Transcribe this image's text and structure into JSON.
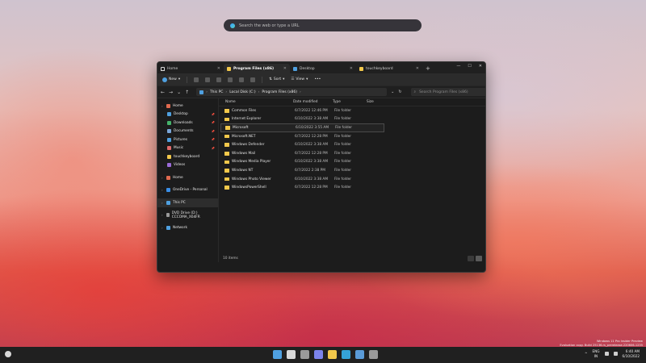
{
  "search": {
    "placeholder": "Search the web or type a URL"
  },
  "tabs": [
    {
      "label": "Home",
      "icon": "home-icon"
    },
    {
      "label": "Program Files (x86)",
      "icon": "folder-icon"
    },
    {
      "label": "Desktop",
      "icon": "desktop-icon"
    },
    {
      "label": "touchkeyboard",
      "icon": "folder-icon"
    }
  ],
  "window_controls": {
    "minimize": "—",
    "maximize": "☐",
    "close": "✕"
  },
  "toolbar": {
    "new_label": "New",
    "sort_label": "Sort",
    "view_label": "View",
    "more_label": "•••"
  },
  "address": {
    "crumbs": [
      "This PC",
      "Local Disk (C:)",
      "Program Files (x86)"
    ],
    "search_placeholder": "Search Program Files (x86)"
  },
  "sidebar": {
    "items": [
      {
        "label": "Home",
        "icon": "home-icon",
        "color": "#e06a4f",
        "level": 0
      },
      {
        "label": "Desktop",
        "icon": "desktop-icon",
        "color": "#4fa0e0",
        "level": 1,
        "pinned": true
      },
      {
        "label": "Downloads",
        "icon": "downloads-icon",
        "color": "#45b36b",
        "level": 1,
        "pinned": true
      },
      {
        "label": "Documents",
        "icon": "documents-icon",
        "color": "#7aa6d8",
        "level": 1,
        "pinned": true
      },
      {
        "label": "Pictures",
        "icon": "pictures-icon",
        "color": "#4fa0e0",
        "level": 1,
        "pinned": true
      },
      {
        "label": "Music",
        "icon": "music-icon",
        "color": "#e06a6a",
        "level": 1,
        "pinned": true
      },
      {
        "label": "touchkeyboard",
        "icon": "folder-icon",
        "color": "#f2c84b",
        "level": 1
      },
      {
        "label": "Videos",
        "icon": "videos-icon",
        "color": "#9b6bd8",
        "level": 1
      },
      {
        "label": "Home",
        "icon": "home-icon",
        "color": "#e06a4f",
        "level": 0,
        "gap": true
      },
      {
        "label": "OneDrive - Personal",
        "icon": "onedrive-icon",
        "color": "#3a8ee6",
        "level": 0,
        "gap": true
      },
      {
        "label": "This PC",
        "icon": "pc-icon",
        "color": "#4fa0e0",
        "level": 0,
        "gap": true,
        "selected": true
      },
      {
        "label": "DVD Drive (D:) CCCOMA_X64FR",
        "icon": "dvd-icon",
        "color": "#9a9a9a",
        "level": 0,
        "gap": true
      },
      {
        "label": "Network",
        "icon": "network-icon",
        "color": "#4fa0e0",
        "level": 0,
        "gap": true
      }
    ]
  },
  "columns": {
    "name": "Name",
    "date": "Date modified",
    "type": "Type",
    "size": "Size"
  },
  "files": [
    {
      "name": "Common Files",
      "date": "6/7/2022 12:46 PM",
      "type": "File folder"
    },
    {
      "name": "Internet Explorer",
      "date": "6/10/2022 3:38 AM",
      "type": "File folder"
    },
    {
      "name": "Microsoft",
      "date": "6/10/2022 3:55 AM",
      "type": "File folder",
      "selected": true
    },
    {
      "name": "Microsoft.NET",
      "date": "6/7/2022 12:28 PM",
      "type": "File folder"
    },
    {
      "name": "Windows Defender",
      "date": "6/10/2022 3:38 AM",
      "type": "File folder"
    },
    {
      "name": "Windows Mail",
      "date": "6/7/2022 12:28 PM",
      "type": "File folder"
    },
    {
      "name": "Windows Media Player",
      "date": "6/10/2022 3:38 AM",
      "type": "File folder"
    },
    {
      "name": "Windows NT",
      "date": "6/7/2022 2:38 PM",
      "type": "File folder"
    },
    {
      "name": "Windows Photo Viewer",
      "date": "6/10/2022 3:38 AM",
      "type": "File folder"
    },
    {
      "name": "WindowsPowerShell",
      "date": "6/7/2022 12:28 PM",
      "type": "File folder"
    }
  ],
  "status": {
    "items_count": "10 items"
  },
  "taskbar": {
    "icons": [
      {
        "name": "start-icon",
        "color": "#4fa0e0"
      },
      {
        "name": "search-icon",
        "color": "#d8d8d8"
      },
      {
        "name": "task-view-icon",
        "color": "#9a9a9a"
      },
      {
        "name": "chat-icon",
        "color": "#7b83eb"
      },
      {
        "name": "file-explorer-icon",
        "color": "#f2c84b"
      },
      {
        "name": "edge-icon",
        "color": "#35a3d8"
      },
      {
        "name": "store-icon",
        "color": "#5a9bd8"
      },
      {
        "name": "settings-icon",
        "color": "#9a9a9a"
      }
    ],
    "lang_line1": "ENG",
    "lang_line2": "IN",
    "time": "6:40 AM",
    "date": "6/10/2022"
  },
  "watermark": {
    "line1": "Windows 11 Pro Insider Preview",
    "line2": "Evaluation copy. Build 25136.rs_prerelease.220606-1235"
  }
}
